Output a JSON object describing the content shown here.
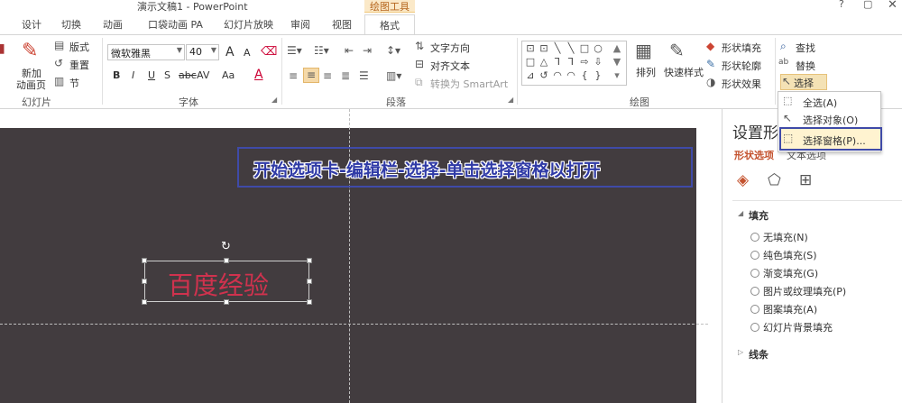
{
  "window": {
    "title": "演示文稿1 - PowerPoint",
    "context_group": "绘图工具",
    "minimize": "?",
    "restore": "▢"
  },
  "tabs": [
    "设计",
    "切换",
    "动画",
    "口袋动画 PA",
    "幻灯片放映",
    "审阅",
    "视图"
  ],
  "active_tab": "格式",
  "ribbon": {
    "slides": {
      "layout": "版式",
      "reset": "重置",
      "section": "节",
      "new_line1": "新加",
      "new_line2": "动画页",
      "group": "幻灯片"
    },
    "font": {
      "name": "微软雅黑",
      "size": "40",
      "group": "字体",
      "bold": "B",
      "italic": "I",
      "underline": "U",
      "shadow": "S",
      "strike": "abc",
      "spacing": "AV",
      "case": "Aa",
      "grow": "A",
      "shrink": "A"
    },
    "paragraph": {
      "text_dir": "文字方向",
      "align_text": "对齐文本",
      "smartart": "转换为 SmartArt",
      "group": "段落"
    },
    "drawing": {
      "arrange": "排列",
      "quick_styles": "快速样式",
      "fill": "形状填充",
      "outline": "形状轮廓",
      "effects": "形状效果",
      "group": "绘图"
    },
    "editing": {
      "find": "查找",
      "replace": "替换",
      "select": "选择"
    }
  },
  "select_menu": {
    "all": "全选(A)",
    "objects": "选择对象(O)",
    "pane": "选择窗格(P)..."
  },
  "slide": {
    "callout": "开始选项卡-编辑栏-选择-单击选择窗格以打开",
    "textbox": "百度经验"
  },
  "format_pane": {
    "title": "设置形",
    "tab_shape": "形状选项",
    "tab_text": "文本选项",
    "fill_section": "填充",
    "fill_options": [
      "无填充(N)",
      "纯色填充(S)",
      "渐变填充(G)",
      "图片或纹理填充(P)",
      "图案填充(A)",
      "幻灯片背景填充"
    ],
    "line_section": "线条"
  },
  "colors": {
    "accent": "#3f4aa8",
    "slide_bg": "#423c3f",
    "text_red": "#d0324e",
    "pane_accent": "#c4532f"
  }
}
